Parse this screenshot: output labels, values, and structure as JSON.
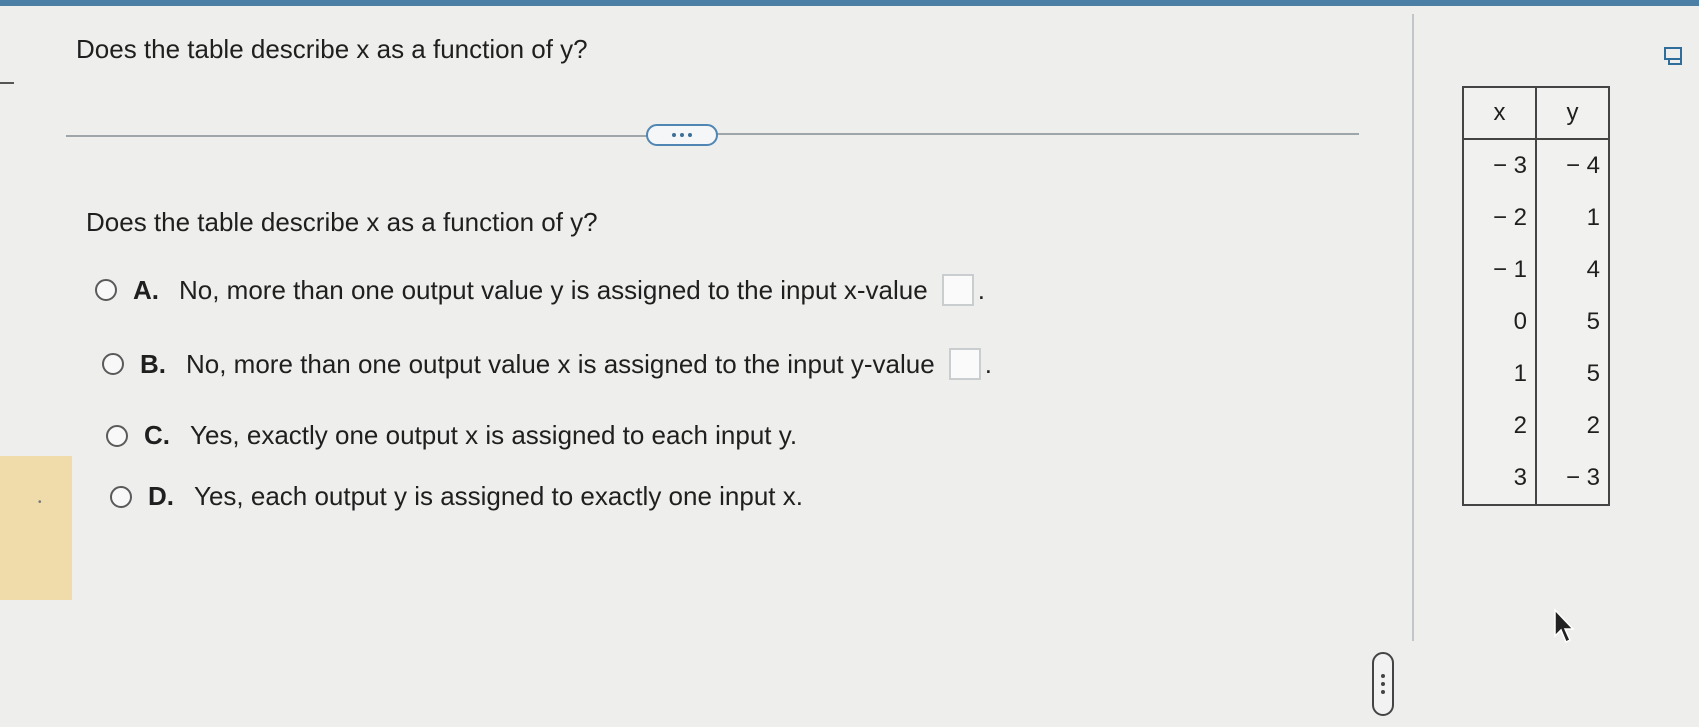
{
  "question": {
    "title": "Does the table describe x as a function of y?",
    "prompt": "Does the table describe x as a function of y?"
  },
  "options": [
    {
      "letter": "A.",
      "text": "No, more than one output value y is assigned to the input x-value",
      "has_box": true
    },
    {
      "letter": "B.",
      "text": "No, more than one output value x is assigned to the input y-value",
      "has_box": true
    },
    {
      "letter": "C.",
      "text": "Yes, exactly one output x is assigned to each input y.",
      "has_box": false
    },
    {
      "letter": "D.",
      "text": "Yes, each output y is assigned to exactly one input x.",
      "has_box": false
    }
  ],
  "punctuation": ".",
  "table": {
    "headers": [
      "x",
      "y"
    ],
    "rows": [
      [
        "− 3",
        "− 4"
      ],
      [
        "− 2",
        "1"
      ],
      [
        "− 1",
        "4"
      ],
      [
        "0",
        "5"
      ],
      [
        "1",
        "5"
      ],
      [
        "2",
        "2"
      ],
      [
        "3",
        "− 3"
      ]
    ]
  },
  "colors": {
    "accent": "#4f86b3",
    "background": "#eeeeec",
    "left_tab": "#efdcaa"
  },
  "icons": [
    "more-options-icon",
    "resize-handle-icon",
    "print-icon",
    "mouse-pointer-icon"
  ]
}
